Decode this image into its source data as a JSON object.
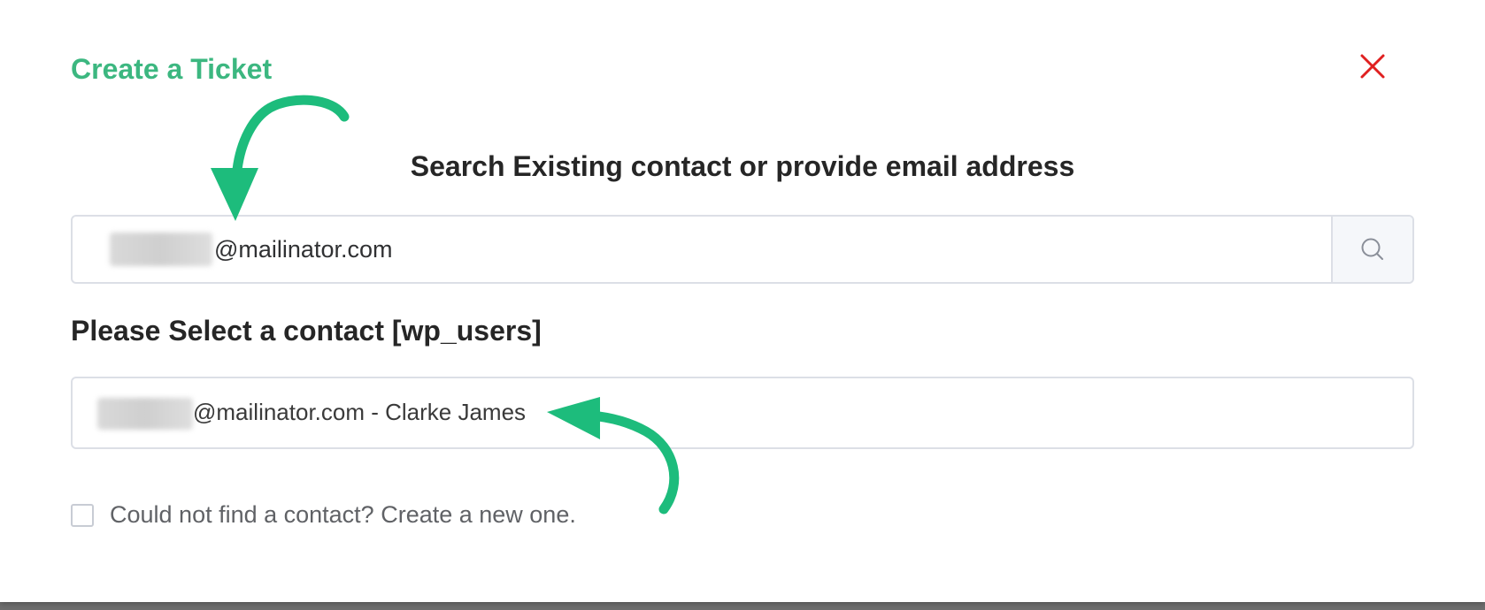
{
  "background": {
    "partial_text_left": "",
    "partial_text_right": ""
  },
  "dialog": {
    "title": "Create a Ticket",
    "heading": "Search Existing contact or provide email address",
    "search": {
      "value": "@mailinator.com",
      "placeholder": ""
    },
    "contact_section_label": "Please Select a contact [wp_users]",
    "selected_contact": "@mailinator.com - Clarke James",
    "create_new_label": "Could not find a contact? Create a new one."
  },
  "colors": {
    "accent": "#3cb780",
    "arrow": "#1dbc7c",
    "close": "#e02020"
  }
}
